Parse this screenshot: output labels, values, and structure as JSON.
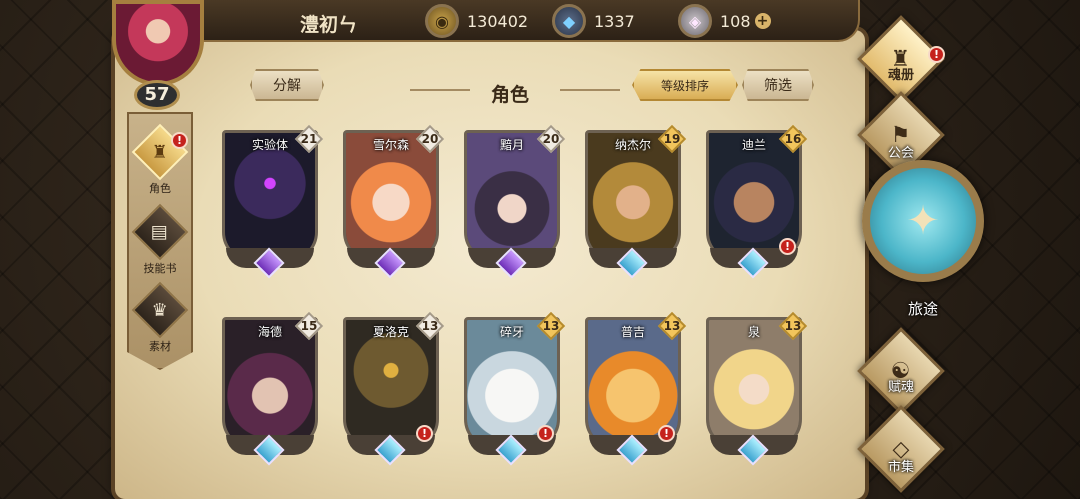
{
  "player": {
    "name": "澧初ㄣ",
    "level": "57"
  },
  "currencies": [
    {
      "icon": "gold-coin-icon",
      "value": "130402"
    },
    {
      "icon": "blue-crystal-icon",
      "value": "1337"
    },
    {
      "icon": "diamond-gem-icon",
      "value": "108"
    }
  ],
  "add_symbol": "+",
  "sidebar": [
    {
      "label": "角色",
      "icon": "character-helmet-icon",
      "active": true,
      "alert": "!"
    },
    {
      "label": "技能书",
      "icon": "skill-book-icon",
      "active": false
    },
    {
      "label": "素材",
      "icon": "material-icon",
      "active": false
    }
  ],
  "toolbar": {
    "decompose": "分解",
    "sort": "等级排序",
    "filter": "筛选"
  },
  "page_title": "角色",
  "characters": [
    {
      "name": "实验体",
      "level": "21",
      "rank": "purple",
      "alert": false
    },
    {
      "name": "雪尔森",
      "level": "20",
      "rank": "purple",
      "alert": false
    },
    {
      "name": "黯月",
      "level": "20",
      "rank": "purple",
      "alert": false
    },
    {
      "name": "纳杰尔",
      "level": "19",
      "rank": "blue",
      "alert": false
    },
    {
      "name": "迪兰",
      "level": "16",
      "rank": "blue",
      "alert": true
    },
    {
      "name": "海德",
      "level": "15",
      "rank": "blue",
      "alert": false
    },
    {
      "name": "夏洛克",
      "level": "13",
      "rank": "blue",
      "alert": true
    },
    {
      "name": "碎牙",
      "level": "13",
      "rank": "blue",
      "alert": true
    },
    {
      "name": "普吉",
      "level": "13",
      "rank": "blue",
      "alert": true
    },
    {
      "name": "泉",
      "level": "13",
      "rank": "blue",
      "alert": false
    }
  ],
  "right_nav": {
    "soul_book": "魂册",
    "guild": "公会",
    "journey": "旅途",
    "soul_endow": "赋魂",
    "market": "市集"
  },
  "alert_symbol": "!"
}
